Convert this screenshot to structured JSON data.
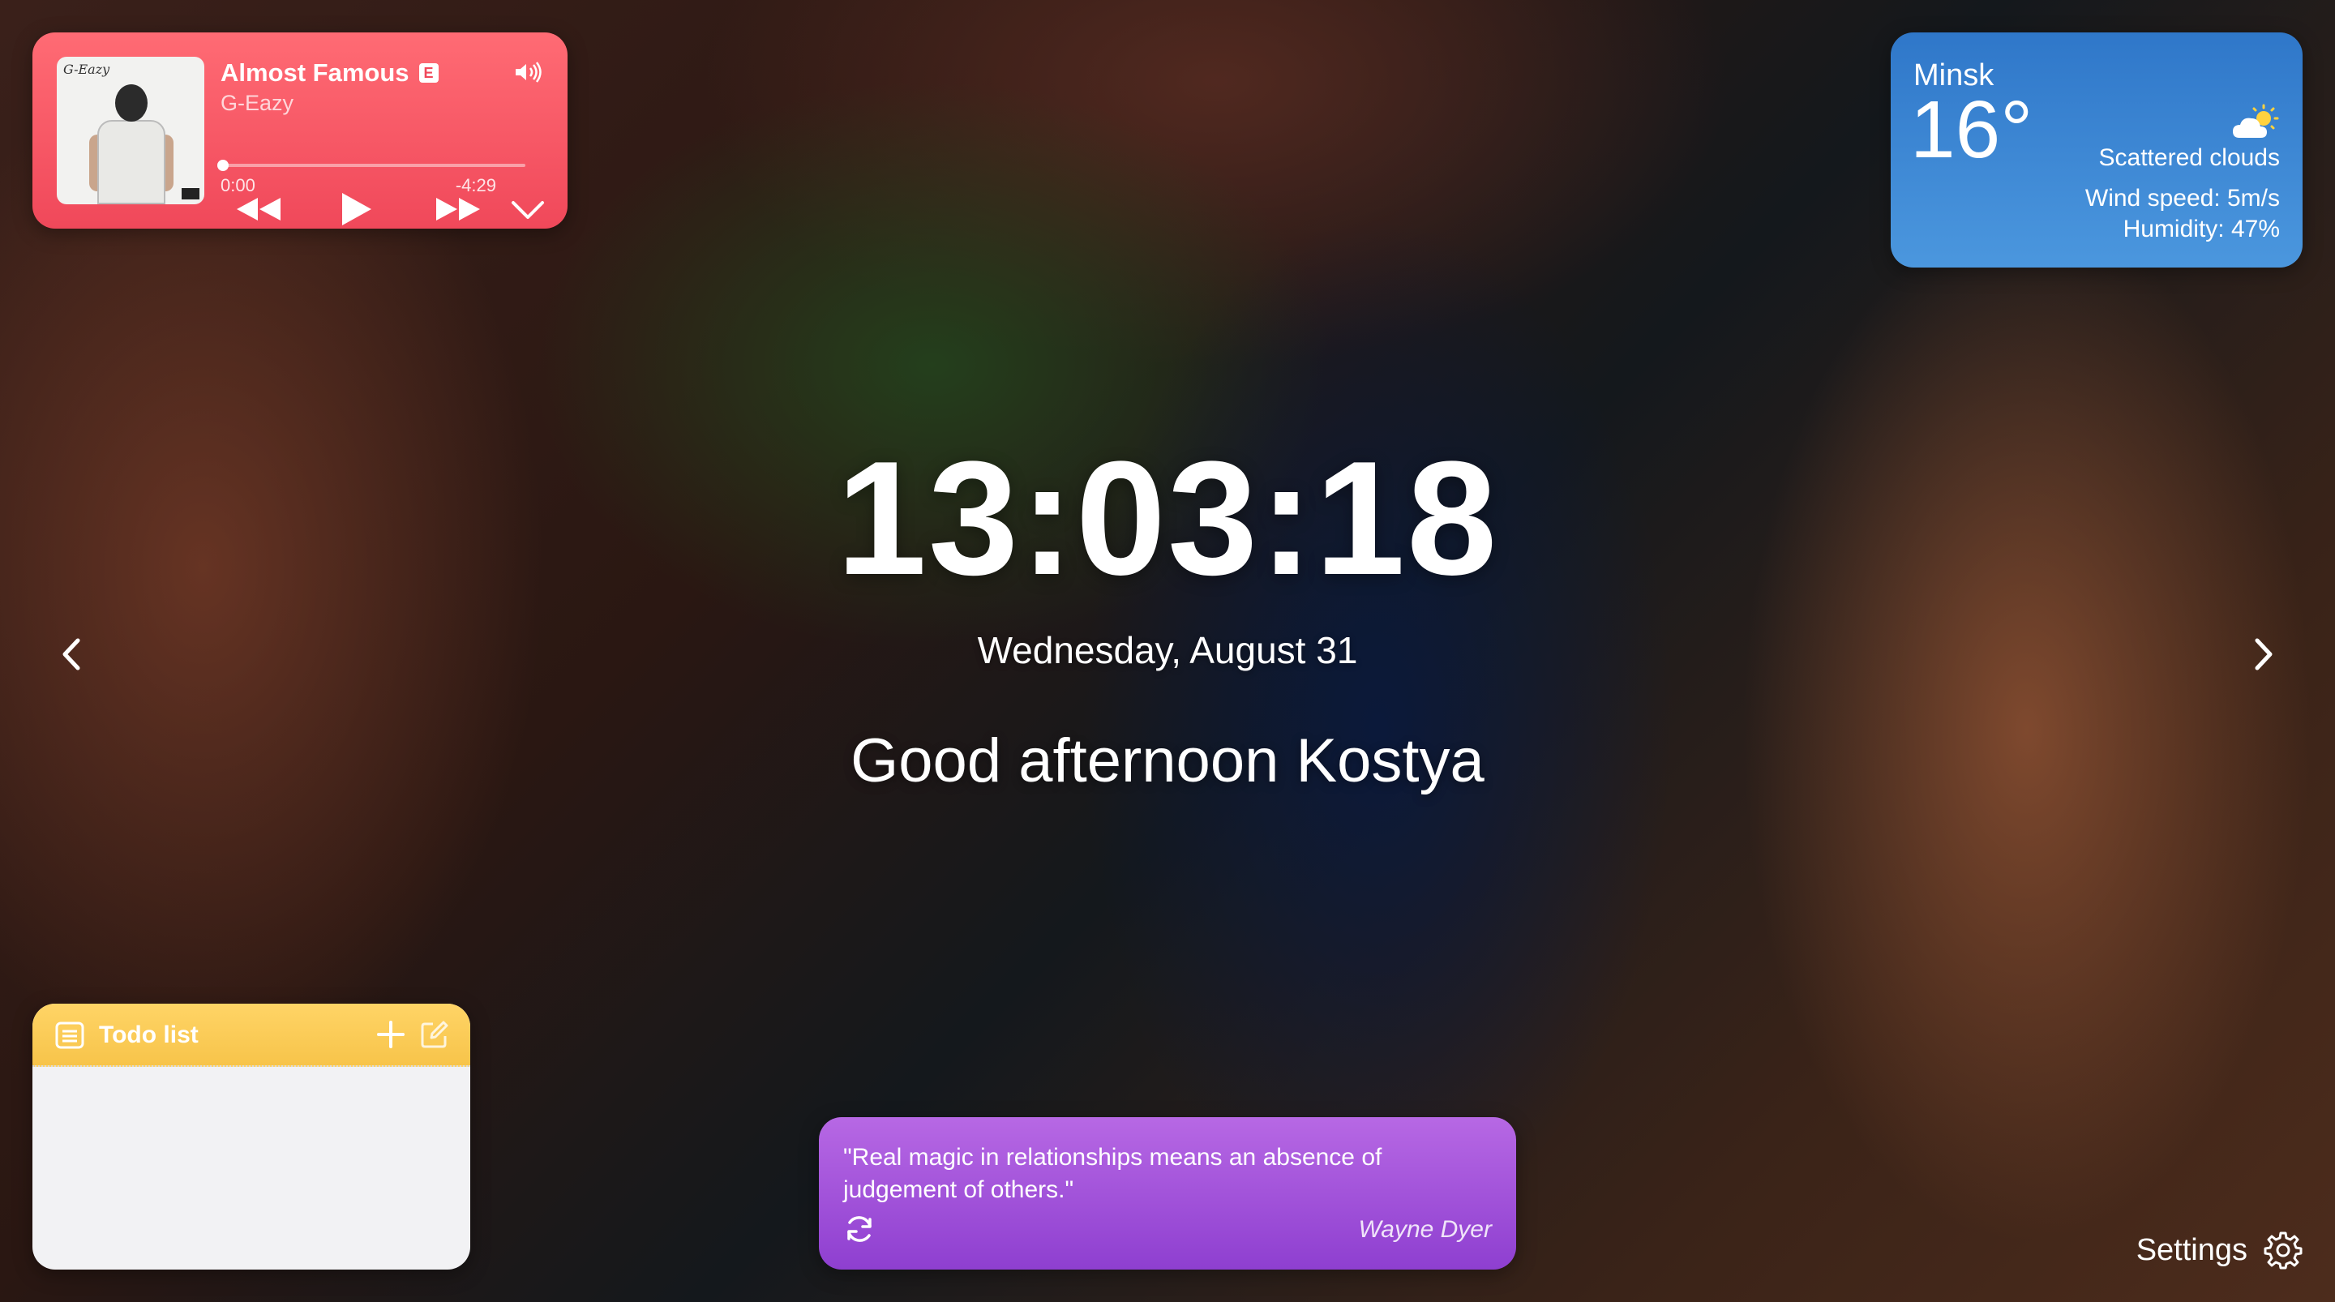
{
  "music": {
    "track_title": "Almost Famous",
    "explicit_badge": "E",
    "artist": "G-Eazy",
    "album_scribble": "G-Eazy",
    "progress": 0.0,
    "time_elapsed": "0:00",
    "time_remaining": "-4:29",
    "icons": [
      "volume-icon",
      "rewind-icon",
      "play-icon",
      "fast-forward-icon",
      "chevron-down-icon"
    ],
    "accent_color": "#f0485a"
  },
  "weather": {
    "city": "Minsk",
    "temperature": "16°",
    "description": "Scattered clouds",
    "wind": "Wind speed: 5m/s",
    "humidity": "Humidity: 47%",
    "icon": "partly-cloudy-icon",
    "accent_color": "#2f77c9"
  },
  "clock": {
    "time": "13:03:18",
    "date": "Wednesday, August 31",
    "greeting": "Good afternoon Kostya"
  },
  "navigation": {
    "prev_icon": "chevron-left-icon",
    "next_icon": "chevron-right-icon"
  },
  "todo": {
    "title": "Todo list",
    "icons": [
      "list-icon",
      "plus-icon",
      "edit-icon"
    ],
    "items": [],
    "accent_color": "#f7c44a"
  },
  "quote": {
    "text": "\"Real magic in relationships means an absence of judgement of others.\"",
    "author": "Wayne Dyer",
    "refresh_icon": "refresh-icon",
    "accent_color": "#9b4fd8"
  },
  "settings": {
    "label": "Settings",
    "icon": "gear-icon"
  }
}
